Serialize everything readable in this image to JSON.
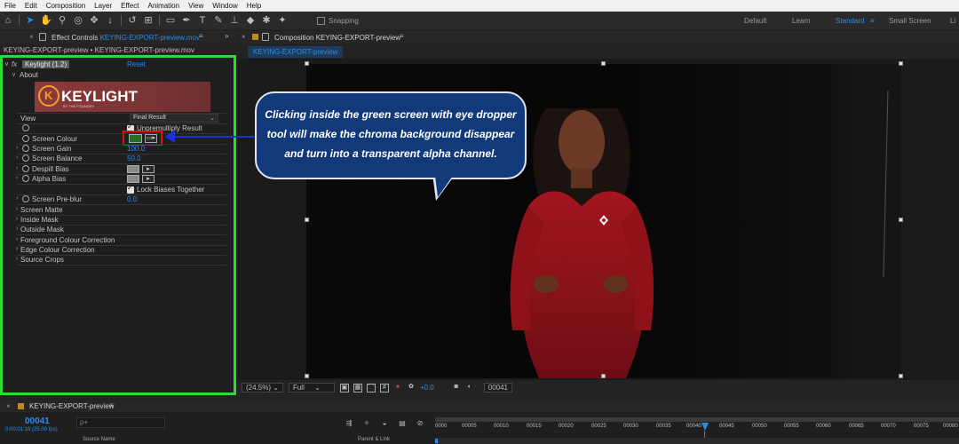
{
  "menu": [
    "File",
    "Edit",
    "Composition",
    "Layer",
    "Effect",
    "Animation",
    "View",
    "Window",
    "Help"
  ],
  "toolbar": {
    "snapping_label": "Snapping",
    "workspaces": [
      {
        "label": "Default",
        "active": false
      },
      {
        "label": "Learn",
        "active": false
      },
      {
        "label": "Standard",
        "active": true
      },
      {
        "label": "Small Screen",
        "active": false
      },
      {
        "label": "Li",
        "active": false
      }
    ]
  },
  "effect_controls": {
    "tab_label": "Effect Controls",
    "tab_layer": "KEYING-EXPORT-preview.mov",
    "subtitle": "KEYING-EXPORT-preview • KEYING-EXPORT-preview.mov",
    "effect_name": "Keylight (1.2)",
    "reset_label": "Reset",
    "about_label": "About",
    "logo_text": "KEYLIGHT",
    "logo_sub": "BY THE FOUNDRY",
    "params": {
      "view": {
        "label": "View",
        "value": "Final Result"
      },
      "unpremultiply": {
        "label": "Unpremultiply Result",
        "checked": true
      },
      "screen_colour": {
        "label": "Screen Colour",
        "swatch": "#2a6a2a"
      },
      "screen_gain": {
        "label": "Screen Gain",
        "value": "100.0"
      },
      "screen_balance": {
        "label": "Screen Balance",
        "value": "50.0"
      },
      "despill_bias": {
        "label": "Despill Bias"
      },
      "alpha_bias": {
        "label": "Alpha Bias"
      },
      "lock_biases": {
        "label": "Lock Biases Together",
        "checked": true
      },
      "screen_preblur": {
        "label": "Screen Pre-blur",
        "value": "0.0"
      }
    },
    "groups": [
      "Screen Matte",
      "Inside Mask",
      "Outside Mask",
      "Foreground Colour Correction",
      "Edge Colour Correction",
      "Source Crops"
    ]
  },
  "composition": {
    "tab_label": "Composition",
    "tab_comp": "KEYING-EXPORT-preview",
    "subtab": "KEYING-EXPORT-preview",
    "annotation": "Clicking inside the green screen with eye dropper tool will make the chroma background disappear and turn into a transparent alpha channel.",
    "footer": {
      "zoom": "(24.5%)",
      "resolution": "Full",
      "exposure": "+0.0",
      "frame": "00041"
    }
  },
  "timeline": {
    "tab_label": "KEYING-EXPORT-preview",
    "timecode": "00041",
    "timecode_sub": "0:00:01:16 (25.00 fps)",
    "search_placeholder": "ρ+",
    "col_source": "Source Name",
    "col_parent": "Parent & Link",
    "ruler_labels": [
      "0000",
      "00005",
      "00010",
      "00015",
      "00020",
      "00025",
      "00030",
      "00035",
      "00040",
      "00045",
      "00050",
      "00055",
      "00060",
      "00065",
      "00070",
      "00075",
      "00080"
    ]
  },
  "colors": {
    "accent": "#2d8ceb",
    "panel_highlight": "#2ed93a",
    "callout_fill": "#123a7a",
    "arrow": "#1b2fe0",
    "swatch_highlight": "#e01010"
  }
}
